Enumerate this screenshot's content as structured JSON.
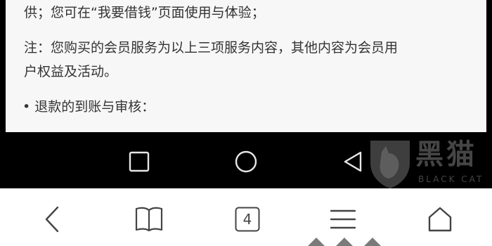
{
  "article": {
    "lines": [
      "供；您可在“我要借钱”页面使用与体验；",
      "注：您购买的会员服务为以上三项服务内容，其他内容为会员用",
      "户权益及活动。",
      "• 退款的到账与审核："
    ]
  },
  "system_nav": {
    "recents_icon": "square-icon",
    "home_icon": "circle-icon",
    "back_icon": "triangle-back-icon"
  },
  "watermark": {
    "title": "黑猫",
    "subtitle": "BLACK CAT"
  },
  "browser_toolbar": {
    "back_icon": "chevron-left-icon",
    "bookmarks_icon": "book-icon",
    "tab_count": "4",
    "menu_icon": "hamburger-icon",
    "home_icon": "house-icon"
  },
  "colors": {
    "content_bg": "#f7f7f7",
    "nav_bg": "#000000",
    "toolbar_bg": "#ffffff",
    "text": "#333333"
  }
}
